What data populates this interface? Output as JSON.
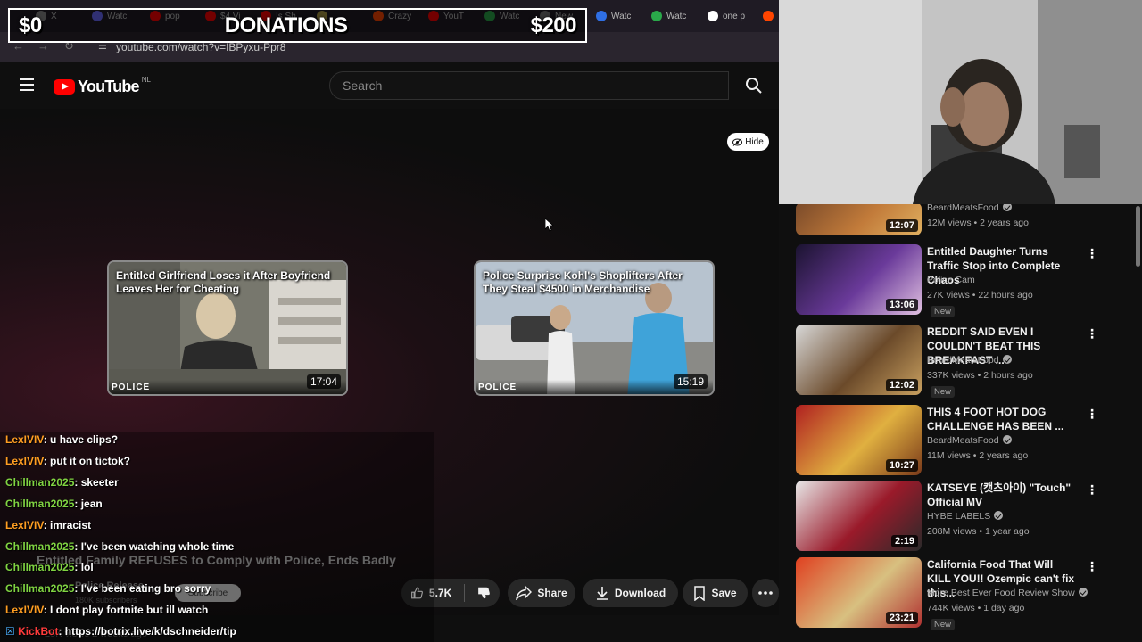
{
  "browser": {
    "tabs": [
      {
        "label": "X",
        "color": "#888888"
      },
      {
        "label": "Watc",
        "color": "#6b6bff"
      },
      {
        "label": "pop",
        "color": "#ff0000"
      },
      {
        "label": "$4 Vi",
        "color": "#ff0000"
      },
      {
        "label": "Is Sh",
        "color": "#ff0000"
      },
      {
        "label": "",
        "color": "#aa9944"
      },
      {
        "label": "Crazy",
        "color": "#ff4500"
      },
      {
        "label": "YouT",
        "color": "#ff0000"
      },
      {
        "label": "Watc",
        "color": "#2aa84a"
      },
      {
        "label": "New",
        "color": "#777777"
      },
      {
        "label": "Watc",
        "color": "#2f6fe4"
      },
      {
        "label": "Watc",
        "color": "#2aa84a"
      },
      {
        "label": "one p",
        "color": "#ffffff"
      },
      {
        "label": "",
        "color": "#ff4500"
      }
    ],
    "url": "youtube.com/watch?v=IBPyxu-Ppr8"
  },
  "donations": {
    "current": "$0",
    "label": "DONATIONS",
    "goal": "$200"
  },
  "header": {
    "logo_text": "YouTube",
    "region": "NL",
    "search_placeholder": "Search"
  },
  "player": {
    "hide_label": "Hide",
    "endcards": [
      {
        "title": "Entitled Girlfriend Loses it After Boyfriend Leaves Her for Cheating",
        "duration": "17:04",
        "tag": "POLICE"
      },
      {
        "title": "Police Surprise Kohl's Shoplifters After They Steal $4500 in Merchandise",
        "duration": "15:19",
        "tag": "POLICE"
      }
    ]
  },
  "chat": [
    {
      "user": "LexIVIV",
      "text": ": u have clips?",
      "color": "orange"
    },
    {
      "user": "LexIVIV",
      "text": ": put it on tictok?",
      "color": "orange"
    },
    {
      "user": "Chillman2025",
      "text": ": skeeter",
      "color": "green"
    },
    {
      "user": "Chillman2025",
      "text": ": jean",
      "color": "green"
    },
    {
      "user": "LexIVIV",
      "text": ": imracist",
      "color": "orange"
    },
    {
      "user": "Chillman2025",
      "text": ": I've been watching whole time",
      "color": "green"
    },
    {
      "user": "Chillman2025",
      "text": ": lol",
      "color": "green"
    },
    {
      "user": "Chillman2025",
      "text": ": I've been eating bro sorry",
      "color": "green"
    },
    {
      "user": "LexIVIV",
      "text": ": I dont play fortnite but ill watch",
      "color": "orange"
    },
    {
      "user": "KickBot",
      "text": ": https://botrix.live/k/dschneider/tip",
      "color": "red"
    }
  ],
  "video": {
    "title": "Entitled Family REFUSES to Comply with Police, Ends Badly",
    "channel": "Police Release",
    "subscribers": "180K subscribers",
    "subscribe_label": "Subscribe",
    "views": "25K views  2 weeks ago",
    "likes": "5.7K",
    "share_label": "Share",
    "download_label": "Download",
    "save_label": "Save"
  },
  "sidebar": [
    {
      "title": "",
      "channel": "BeardMeatsFood",
      "meta": "12M views • 2 years ago",
      "duration": "12:07",
      "badge": "",
      "verified": true
    },
    {
      "title": "Entitled Daughter Turns Traffic Stop into Complete Chaos",
      "channel": "Police Cam",
      "meta": "27K views • 22 hours ago",
      "duration": "13:06",
      "badge": "New",
      "verified": false
    },
    {
      "title": "REDDIT SAID EVEN I COULDN'T BEAT THIS BREAKFAST ...",
      "channel": "BeardMeatsFood",
      "meta": "337K views • 2 hours ago",
      "duration": "12:02",
      "badge": "New",
      "verified": true
    },
    {
      "title": "THIS 4 FOOT HOT DOG CHALLENGE HAS BEEN ...",
      "channel": "BeardMeatsFood",
      "meta": "11M views • 2 years ago",
      "duration": "10:27",
      "badge": "",
      "verified": true
    },
    {
      "title": "KATSEYE (캣츠아이) \"Touch\" Official MV",
      "channel": "HYBE LABELS",
      "meta": "208M views • 1 year ago",
      "duration": "2:19",
      "badge": "",
      "verified": true
    },
    {
      "title": "California Food That Will KILL YOU!! Ozempic can't fix this...",
      "channel": "More Best Ever Food Review Show",
      "meta": "744K views • 1 day ago",
      "duration": "23:21",
      "badge": "New",
      "verified": true
    }
  ]
}
